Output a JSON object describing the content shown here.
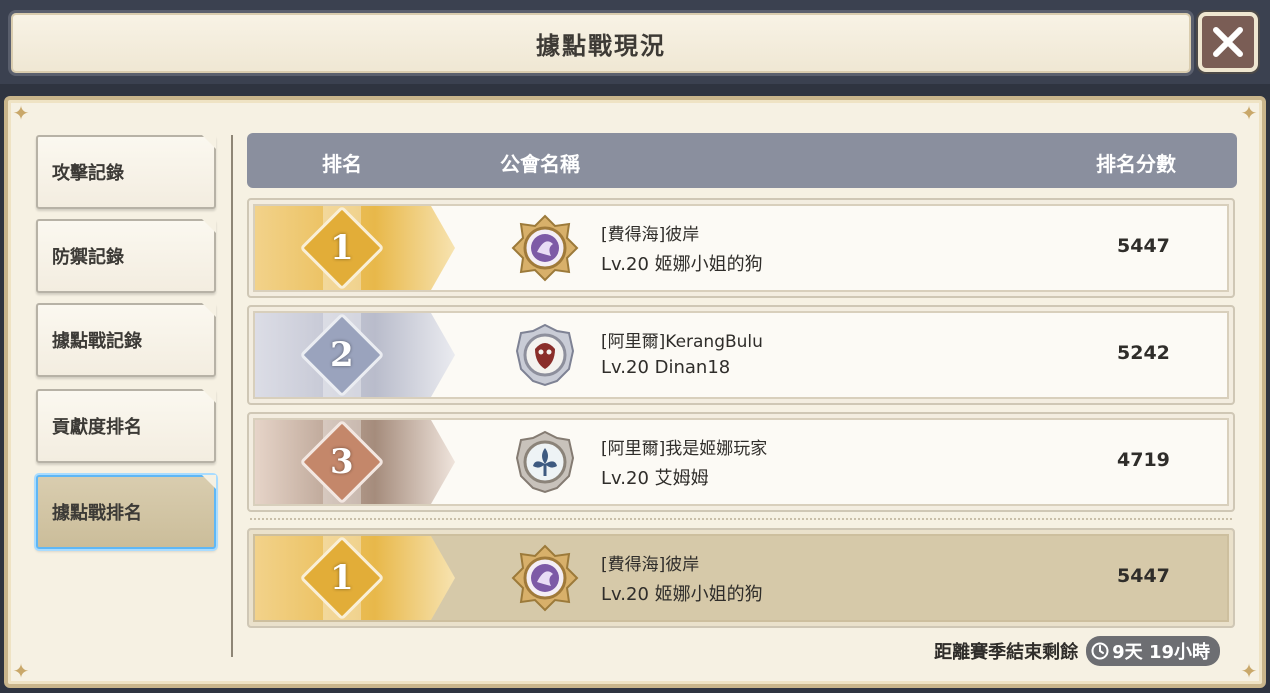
{
  "header": {
    "title": "據點戰現況"
  },
  "sidebar": {
    "items": [
      {
        "label": "攻擊記錄",
        "active": false
      },
      {
        "label": "防禦記錄",
        "active": false
      },
      {
        "label": "據點戰記錄",
        "active": false
      },
      {
        "label": "貢獻度排名",
        "active": false
      },
      {
        "label": "據點戰排名",
        "active": true
      }
    ]
  },
  "table": {
    "columns": {
      "rank": "排名",
      "guild": "公會名稱",
      "score": "排名分數"
    },
    "rows": [
      {
        "rank": "1",
        "medal": "gold",
        "emblem": "dragon-emblem-icon",
        "guild": "[費得海]彼岸",
        "leader": "Lv.20 姬娜小姐的狗",
        "score": "5447"
      },
      {
        "rank": "2",
        "medal": "silver",
        "emblem": "mask-emblem-icon",
        "guild": "[阿里爾]KerangBulu",
        "leader": "Lv.20 Dinan18",
        "score": "5242"
      },
      {
        "rank": "3",
        "medal": "bronze",
        "emblem": "flower-emblem-icon",
        "guild": "[阿里爾]我是姬娜玩家",
        "leader": "Lv.20 艾姆姆",
        "score": "4719"
      }
    ],
    "my_guild": {
      "rank": "1",
      "medal": "gold",
      "emblem": "dragon-emblem-icon",
      "guild": "[費得海]彼岸",
      "leader": "Lv.20 姬娜小姐的狗",
      "score": "5447"
    }
  },
  "season": {
    "label": "距離賽季結束剩餘",
    "remaining": "9天 19小時"
  },
  "colors": {
    "gold": "#e8b84a",
    "silver": "#b9bccb",
    "bronze": "#a58c7c",
    "active_border": "#5fb7f5"
  }
}
